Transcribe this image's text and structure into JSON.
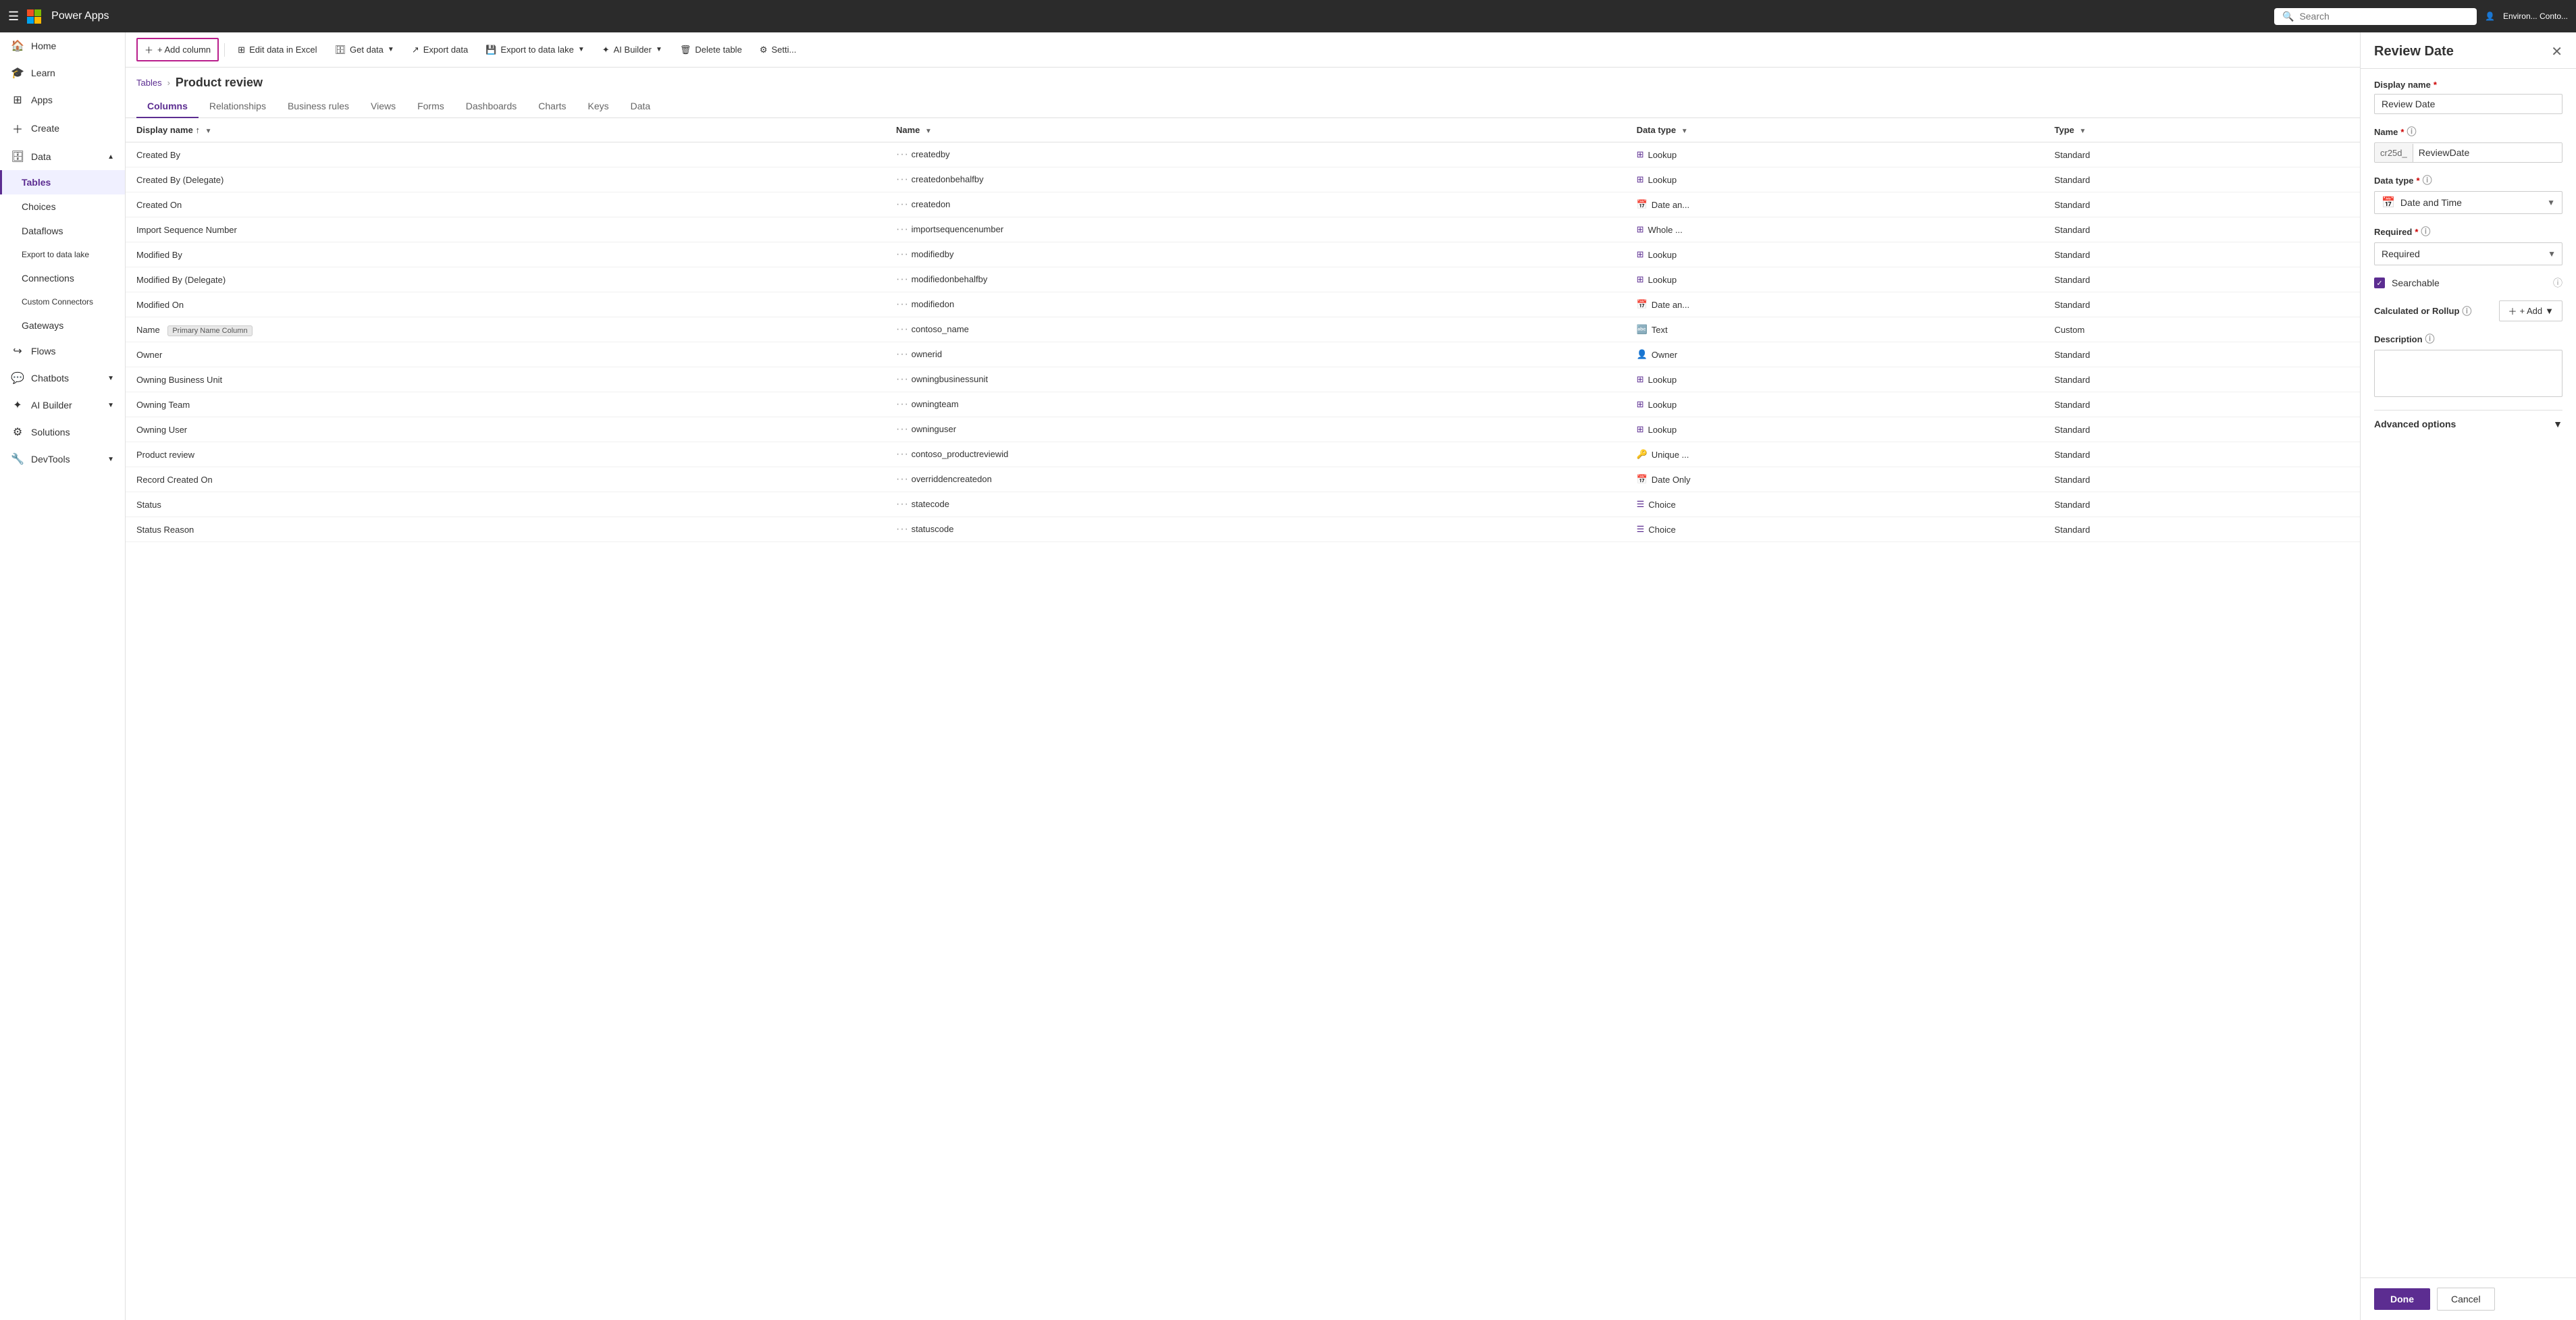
{
  "topNav": {
    "appName": "Power Apps",
    "searchPlaceholder": "Search",
    "environment": "Environ... Conto..."
  },
  "sidebar": {
    "items": [
      {
        "id": "home",
        "label": "Home",
        "icon": "🏠",
        "active": false
      },
      {
        "id": "learn",
        "label": "Learn",
        "icon": "🎓",
        "active": false
      },
      {
        "id": "apps",
        "label": "Apps",
        "icon": "⊞",
        "active": false
      },
      {
        "id": "create",
        "label": "Create",
        "icon": "+",
        "active": false
      },
      {
        "id": "data",
        "label": "Data",
        "icon": "🗄",
        "active": true,
        "expanded": true
      },
      {
        "id": "tables",
        "label": "Tables",
        "icon": "",
        "active": true,
        "sub": true
      },
      {
        "id": "choices",
        "label": "Choices",
        "icon": "",
        "active": false,
        "sub": true
      },
      {
        "id": "dataflows",
        "label": "Dataflows",
        "icon": "",
        "active": false,
        "sub": true
      },
      {
        "id": "exportdatalake",
        "label": "Export to data lake",
        "icon": "",
        "active": false,
        "sub": true
      },
      {
        "id": "connections",
        "label": "Connections",
        "icon": "",
        "active": false,
        "sub": true
      },
      {
        "id": "customconnectors",
        "label": "Custom Connectors",
        "icon": "",
        "active": false,
        "sub": true
      },
      {
        "id": "gateways",
        "label": "Gateways",
        "icon": "",
        "active": false,
        "sub": true
      },
      {
        "id": "flows",
        "label": "Flows",
        "icon": "↪",
        "active": false
      },
      {
        "id": "chatbots",
        "label": "Chatbots",
        "icon": "💬",
        "active": false,
        "chevron": true
      },
      {
        "id": "aibuilder",
        "label": "AI Builder",
        "icon": "✦",
        "active": false,
        "chevron": true
      },
      {
        "id": "solutions",
        "label": "Solutions",
        "icon": "⚙",
        "active": false
      },
      {
        "id": "devtools",
        "label": "DevTools",
        "icon": "",
        "active": false,
        "chevron": true
      }
    ]
  },
  "toolbar": {
    "addColumnLabel": "+ Add column",
    "editExcelLabel": "Edit data in Excel",
    "getDataLabel": "Get data",
    "exportDataLabel": "Export data",
    "exportDataLakeLabel": "Export to data lake",
    "aiBuilderLabel": "AI Builder",
    "deleteTableLabel": "Delete table",
    "settingsLabel": "Setti..."
  },
  "breadcrumb": {
    "parent": "Tables",
    "current": "Product review"
  },
  "tabs": [
    {
      "id": "columns",
      "label": "Columns",
      "active": true
    },
    {
      "id": "relationships",
      "label": "Relationships",
      "active": false
    },
    {
      "id": "businessrules",
      "label": "Business rules",
      "active": false
    },
    {
      "id": "views",
      "label": "Views",
      "active": false
    },
    {
      "id": "forms",
      "label": "Forms",
      "active": false
    },
    {
      "id": "dashboards",
      "label": "Dashboards",
      "active": false
    },
    {
      "id": "charts",
      "label": "Charts",
      "active": false
    },
    {
      "id": "keys",
      "label": "Keys",
      "active": false
    },
    {
      "id": "data",
      "label": "Data",
      "active": false
    }
  ],
  "tableHeaders": {
    "displayName": "Display name",
    "name": "Name",
    "dataType": "Data type",
    "type": "Type"
  },
  "tableRows": [
    {
      "displayName": "Created By",
      "name": "createdby",
      "dataType": "Lookup",
      "dataTypeIcon": "grid",
      "type": "Standard"
    },
    {
      "displayName": "Created By (Delegate)",
      "name": "createdonbehalfby",
      "dataType": "Lookup",
      "dataTypeIcon": "grid",
      "type": "Standard"
    },
    {
      "displayName": "Created On",
      "name": "createdon",
      "dataType": "Date an...",
      "dataTypeIcon": "calendar",
      "type": "Standard"
    },
    {
      "displayName": "Import Sequence Number",
      "name": "importsequencenumber",
      "dataType": "Whole ...",
      "dataTypeIcon": "grid",
      "type": "Standard"
    },
    {
      "displayName": "Modified By",
      "name": "modifiedby",
      "dataType": "Lookup",
      "dataTypeIcon": "grid",
      "type": "Standard"
    },
    {
      "displayName": "Modified By (Delegate)",
      "name": "modifiedonbehalfby",
      "dataType": "Lookup",
      "dataTypeIcon": "grid",
      "type": "Standard"
    },
    {
      "displayName": "Modified On",
      "name": "modifiedon",
      "dataType": "Date an...",
      "dataTypeIcon": "calendar",
      "type": "Standard"
    },
    {
      "displayName": "Name",
      "name": "contoso_name",
      "dataType": "Text",
      "dataTypeIcon": "text",
      "type": "Custom",
      "badge": "Primary Name Column"
    },
    {
      "displayName": "Owner",
      "name": "ownerid",
      "dataType": "Owner",
      "dataTypeIcon": "person",
      "type": "Standard"
    },
    {
      "displayName": "Owning Business Unit",
      "name": "owningbusinessunit",
      "dataType": "Lookup",
      "dataTypeIcon": "grid",
      "type": "Standard"
    },
    {
      "displayName": "Owning Team",
      "name": "owningteam",
      "dataType": "Lookup",
      "dataTypeIcon": "grid",
      "type": "Standard"
    },
    {
      "displayName": "Owning User",
      "name": "owninguser",
      "dataType": "Lookup",
      "dataTypeIcon": "grid",
      "type": "Standard"
    },
    {
      "displayName": "Product review",
      "name": "contoso_productreviewid",
      "dataType": "Unique ...",
      "dataTypeIcon": "key",
      "type": "Standard"
    },
    {
      "displayName": "Record Created On",
      "name": "overriddencreatedon",
      "dataType": "Date Only",
      "dataTypeIcon": "calendar",
      "type": "Standard"
    },
    {
      "displayName": "Status",
      "name": "statecode",
      "dataType": "Choice",
      "dataTypeIcon": "list",
      "type": "Standard"
    },
    {
      "displayName": "Status Reason",
      "name": "statuscode",
      "dataType": "Choice",
      "dataTypeIcon": "list",
      "type": "Standard"
    }
  ],
  "rightPanel": {
    "title": "Review Date",
    "fields": {
      "displayNameLabel": "Display name",
      "displayNameValue": "Review Date",
      "nameLabel": "Name",
      "namePrefix": "cr25d_",
      "nameValue": "ReviewDate",
      "dataTypeLabel": "Data type",
      "dataTypeValue": "Date and Time",
      "dataTypeIcon": "📅",
      "requiredLabel": "Required",
      "requiredValue": "Required",
      "searchableLabel": "Searchable",
      "calcRollupLabel": "Calculated or Rollup",
      "addLabel": "+ Add",
      "descriptionLabel": "Description",
      "advancedLabel": "Advanced options"
    },
    "footer": {
      "doneLabel": "Done",
      "cancelLabel": "Cancel"
    }
  }
}
